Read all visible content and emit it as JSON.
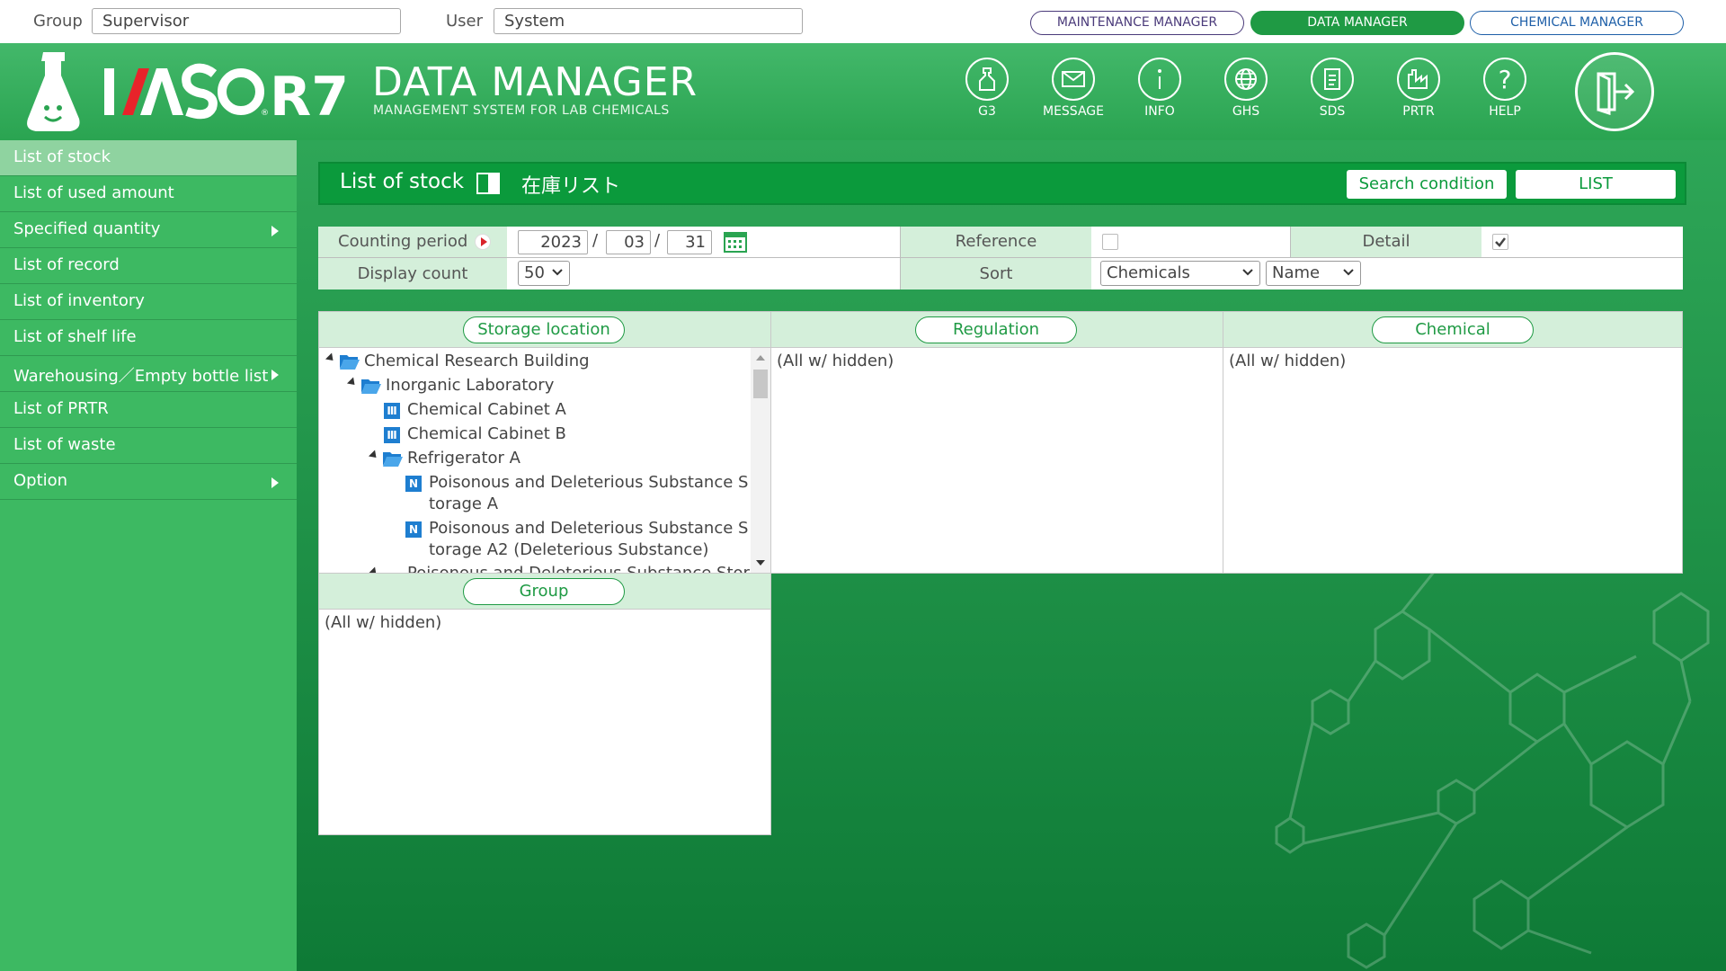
{
  "topbar": {
    "group_label": "Group",
    "group_value": "Supervisor",
    "user_label": "User",
    "user_value": "System",
    "managers": [
      "MAINTENANCE MANAGER",
      "DATA MANAGER",
      "CHEMICAL MANAGER"
    ]
  },
  "header": {
    "brand": "IASO R7",
    "title": "DATA MANAGER",
    "subtitle": "MANAGEMENT SYSTEM FOR LAB CHEMICALS",
    "icons": [
      {
        "label": "G3",
        "icon": "bottle-icon"
      },
      {
        "label": "MESSAGE",
        "icon": "envelope-icon"
      },
      {
        "label": "INFO",
        "icon": "info-icon"
      },
      {
        "label": "GHS",
        "icon": "globe-icon"
      },
      {
        "label": "SDS",
        "icon": "document-icon"
      },
      {
        "label": "PRTR",
        "icon": "factory-icon"
      },
      {
        "label": "HELP",
        "icon": "help-icon"
      }
    ]
  },
  "sidebar": {
    "items": [
      {
        "label": "List of stock"
      },
      {
        "label": "List of used amount"
      },
      {
        "label": "Specified quantity"
      },
      {
        "label": "List of record"
      },
      {
        "label": "List of inventory"
      },
      {
        "label": "List of shelf life"
      },
      {
        "label": "Warehousing／Empty bottle list"
      },
      {
        "label": "List of PRTR"
      },
      {
        "label": "List of waste"
      },
      {
        "label": "Option"
      }
    ]
  },
  "main": {
    "title": "List of stock",
    "title_ja": "在庫リスト",
    "search_condition": "Search condition",
    "list_button": "LIST"
  },
  "conditions": {
    "counting_period_label": "Counting period",
    "year": "2023",
    "month": "03",
    "day": "31",
    "date_sep": "/",
    "reference_label": "Reference",
    "reference_checked": false,
    "detail_label": "Detail",
    "detail_checked": true,
    "display_count_label": "Display count",
    "display_count": "50",
    "sort_label": "Sort",
    "sort_field": "Chemicals",
    "sort_key": "Name"
  },
  "panels": {
    "storage_label": "Storage location",
    "regulation_label": "Regulation",
    "chemical_label": "Chemical",
    "group_label": "Group",
    "all_hidden": "(All w/ hidden)",
    "tree": [
      "Chemical Research Building",
      "Inorganic Laboratory",
      "Chemical Cabinet A",
      "Chemical Cabinet B",
      "Refrigerator A",
      "Poisonous and Deleterious Substance S",
      "torage A",
      "Poisonous and Deleterious Substance S",
      "torage A2 (Deleterious Substance)",
      "Poisonous and Deleterious Substance Stor"
    ]
  },
  "colors": {
    "brand_green": "#1f9a44",
    "header_green": "#3db962",
    "active_side": "#8fd3a0",
    "panel_head": "#d4efda"
  }
}
